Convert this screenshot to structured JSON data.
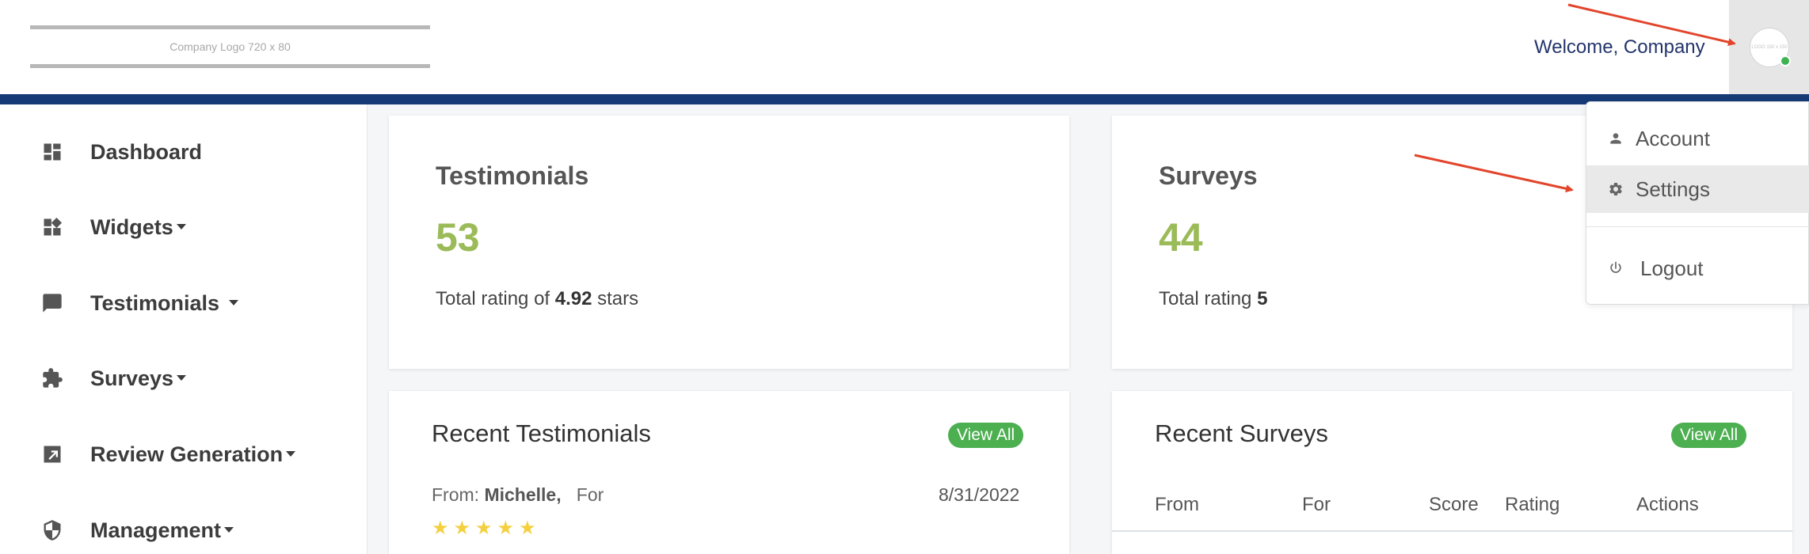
{
  "header": {
    "logo_text": "Company Logo 720 x 80",
    "welcome_text": "Welcome, Company",
    "avatar_text": "LOGO 150 x 150"
  },
  "sidebar": {
    "items": [
      {
        "label": "Dashboard",
        "icon": "dashboard-icon",
        "has_caret": false
      },
      {
        "label": "Widgets",
        "icon": "widgets-icon",
        "has_caret": true
      },
      {
        "label": "Testimonials",
        "icon": "chat-bubble-icon",
        "has_caret": true
      },
      {
        "label": "Surveys",
        "icon": "puzzle-icon",
        "has_caret": true
      },
      {
        "label": "Review Generation",
        "icon": "external-link-icon",
        "has_caret": true
      },
      {
        "label": "Management",
        "icon": "shield-icon",
        "has_caret": true
      }
    ]
  },
  "stats": {
    "testimonials": {
      "title": "Testimonials",
      "value": "53",
      "sub_prefix": "Total rating of ",
      "sub_bold": "4.92",
      "sub_suffix": " stars"
    },
    "surveys": {
      "title": "Surveys",
      "value": "44",
      "sub_prefix": "Total rating ",
      "sub_bold": "5"
    }
  },
  "recent_testimonials": {
    "title": "Recent Testimonials",
    "view_all": "View All",
    "rows": [
      {
        "from_label": "From:",
        "from_name": "Michelle,",
        "for_label": "For",
        "date": "8/31/2022",
        "rating": 5
      }
    ]
  },
  "recent_surveys": {
    "title": "Recent Surveys",
    "view_all": "View All",
    "columns": [
      "From",
      "For",
      "Score",
      "Rating",
      "Actions"
    ]
  },
  "dropdown": {
    "items": [
      {
        "label": "Account",
        "icon": "person-icon"
      },
      {
        "label": "Settings",
        "icon": "gear-icon",
        "active": true
      },
      {
        "label": "Logout",
        "icon": "power-icon"
      }
    ]
  },
  "colors": {
    "navbar": "#163a75",
    "accent_green": "#9bbb59",
    "pill_green": "#4caf50",
    "annotation_arrow": "#e2452b"
  }
}
